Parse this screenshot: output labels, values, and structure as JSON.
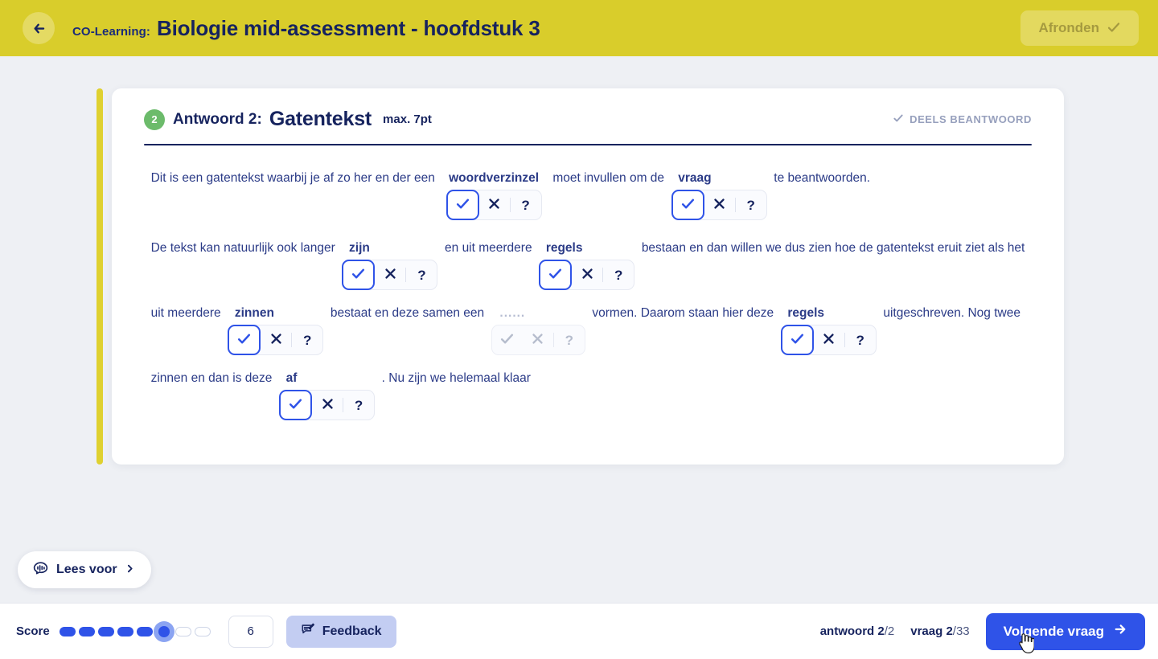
{
  "header": {
    "back_icon": "arrow-left-icon",
    "brand": "CO-Learning:",
    "title": "Biologie mid-assessment - hoofdstuk 3",
    "finish_label": "Afronden",
    "finish_icon": "check-icon",
    "bg_color": "#d9cd2b",
    "finish_disabled": true
  },
  "card": {
    "accent_color": "#dfd130",
    "badge_number": "2",
    "badge_color": "#6cbb6b",
    "answer_label": "Antwoord 2:",
    "answer_type": "Gatentekst",
    "max_points": "max. 7pt",
    "status_icon": "check-icon",
    "status_text": "DEELS BEANTWOORD"
  },
  "cloze": {
    "lines": [
      {
        "segments": [
          {
            "text": "Dit is een gatentekst waarbij je af zo her en der een",
            "style": "normal",
            "widget": null
          },
          {
            "text": "woordverzinzel",
            "style": "bold",
            "widget": {
              "state": "check",
              "enabled": true
            }
          },
          {
            "text": "moet invullen om de",
            "style": "normal",
            "widget": null
          },
          {
            "text": "vraag",
            "style": "bold",
            "widget": {
              "state": "check",
              "enabled": true
            }
          },
          {
            "text": "te beantwoorden.",
            "style": "normal",
            "widget": null
          }
        ]
      },
      {
        "segments": [
          {
            "text": "De tekst kan natuurlijk ook langer",
            "style": "normal",
            "widget": null
          },
          {
            "text": "zijn",
            "style": "bold",
            "widget": {
              "state": "check",
              "enabled": true
            }
          },
          {
            "text": "en uit meerdere",
            "style": "normal",
            "widget": null
          },
          {
            "text": "regels",
            "style": "bold",
            "widget": {
              "state": "check",
              "enabled": true
            }
          },
          {
            "text": "bestaan en dan willen we dus zien hoe de gatentekst eruit ziet als het",
            "style": "normal",
            "widget": null
          }
        ]
      },
      {
        "segments": [
          {
            "text": "uit meerdere",
            "style": "normal",
            "widget": null
          },
          {
            "text": "zinnen",
            "style": "bold",
            "widget": {
              "state": "check",
              "enabled": true
            }
          },
          {
            "text": "bestaat en deze samen een",
            "style": "normal",
            "widget": null
          },
          {
            "text": "......",
            "style": "dots",
            "widget": {
              "state": "none",
              "enabled": false
            }
          },
          {
            "text": "vormen. Daarom staan hier deze",
            "style": "normal",
            "widget": null
          },
          {
            "text": "regels",
            "style": "bold",
            "widget": {
              "state": "check",
              "enabled": true
            }
          },
          {
            "text": "uitgeschreven. Nog twee",
            "style": "normal",
            "widget": null
          }
        ]
      },
      {
        "segments": [
          {
            "text": "zinnen en dan is deze",
            "style": "normal",
            "widget": null
          },
          {
            "text": "af",
            "style": "bold",
            "widget": {
              "state": "check",
              "enabled": true
            }
          },
          {
            "text": ". Nu zijn we helemaal klaar",
            "style": "normal",
            "widget": null
          }
        ]
      }
    ],
    "widget_options": {
      "correct_icon": "check-icon",
      "incorrect_icon": "cross-icon",
      "unknown_icon": "question-mark-icon",
      "unknown_label": "?"
    }
  },
  "read_aloud": {
    "icon": "speech-waveform-icon",
    "label": "Lees voor",
    "chevron": "chevron-right-icon"
  },
  "footer": {
    "score_label": "Score",
    "score_value": "6",
    "slider_filled": 6,
    "slider_total": 8,
    "slider_color": "#2f53e8",
    "feedback_icon": "comment-edit-icon",
    "feedback_label": "Feedback",
    "answer_counter_prefix": "antwoord",
    "answer_counter_current": "2",
    "answer_counter_total": "/2",
    "question_counter_prefix": "vraag",
    "question_counter_current": "2",
    "question_counter_total": "/33",
    "next_label": "Volgende vraag",
    "next_icon": "arrow-right-icon",
    "next_color": "#2f53e8"
  }
}
